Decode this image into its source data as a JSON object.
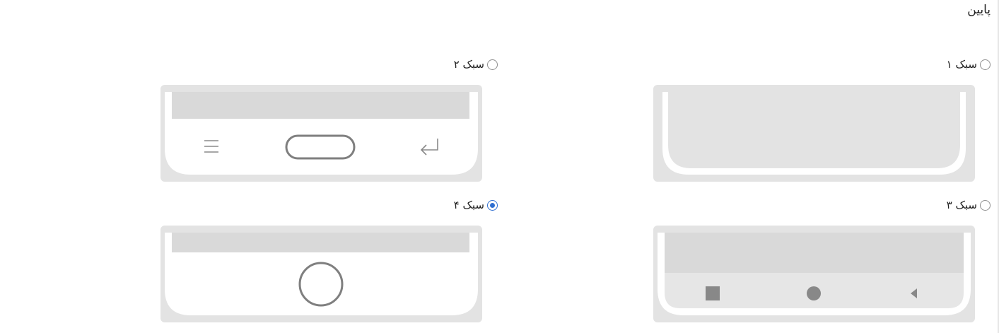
{
  "section": {
    "title": "پایین"
  },
  "options": [
    {
      "label": "سبک ۱",
      "checked": false
    },
    {
      "label": "سبک ۲",
      "checked": false
    },
    {
      "label": "سبک ۳",
      "checked": false
    },
    {
      "label": "سبک ۴",
      "checked": true
    }
  ],
  "colors": {
    "frame": "#e3e3e3",
    "screen": "#d9d9d9",
    "icon": "#8a8a8a",
    "radio_checked": "#2f6fd1"
  }
}
